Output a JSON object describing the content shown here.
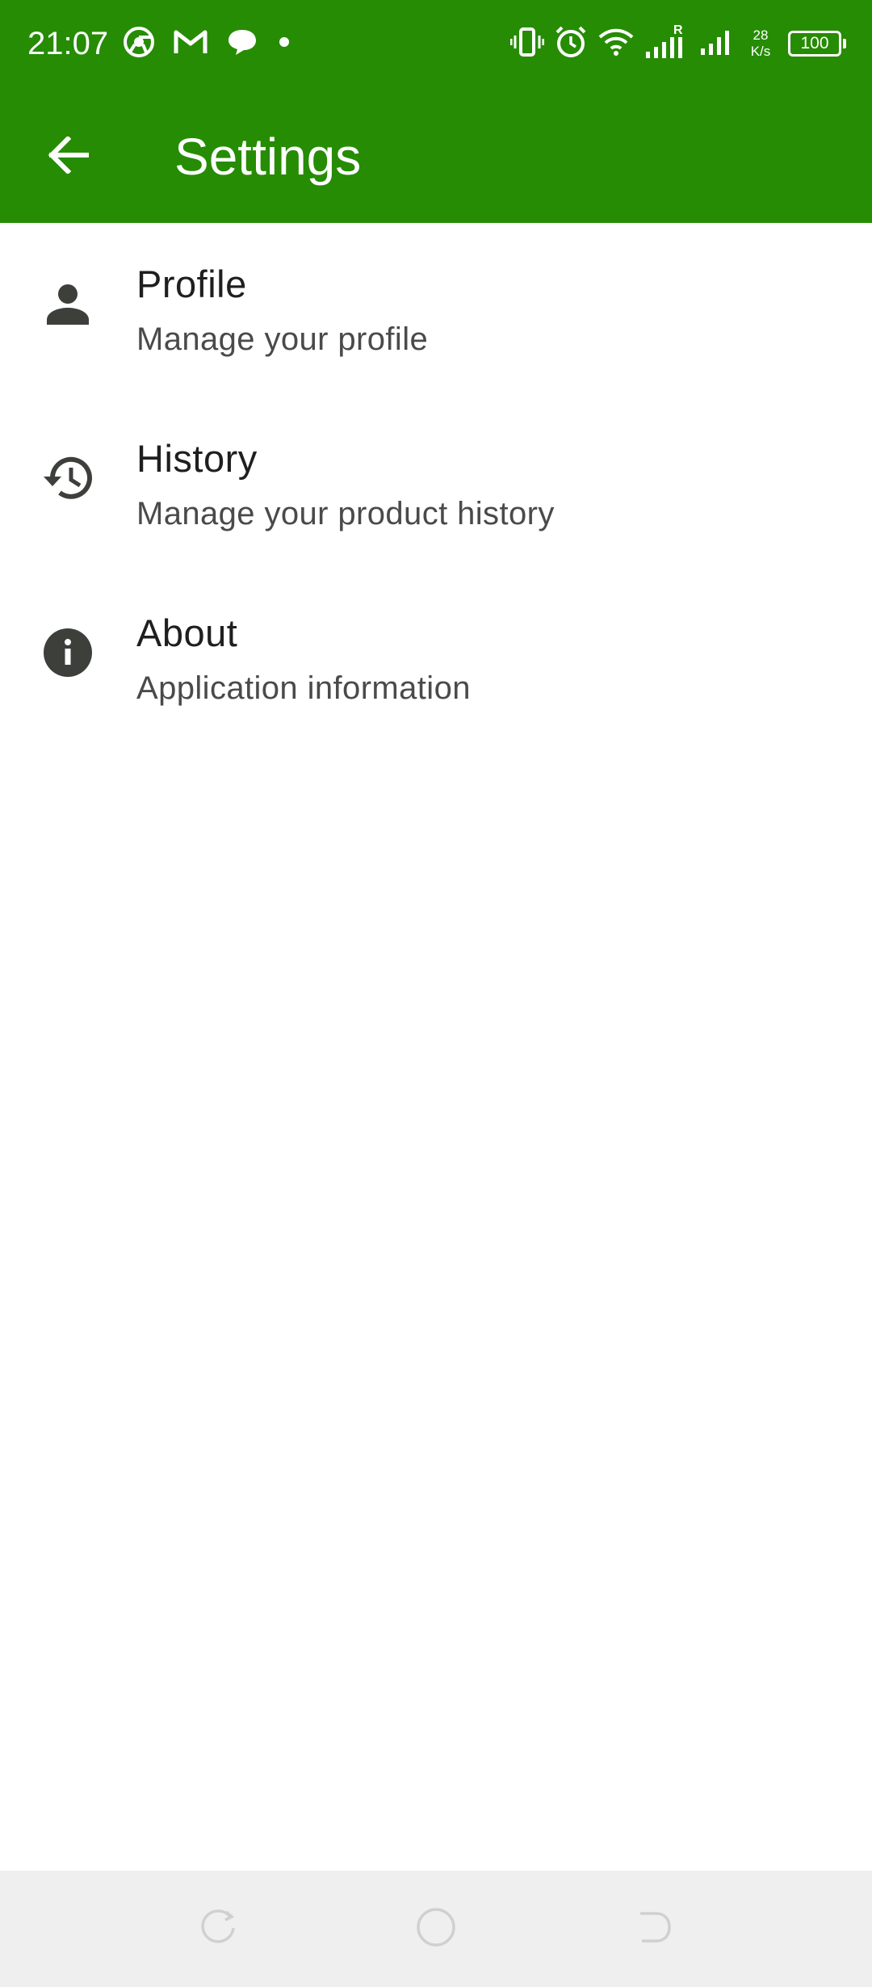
{
  "status_bar": {
    "time": "21:07",
    "net_speed_value": "28",
    "net_speed_unit": "K/s",
    "battery": "100",
    "icons": [
      "chrome-icon",
      "gmail-icon",
      "chat-icon",
      "dot-icon",
      "vibrate-icon",
      "alarm-icon",
      "wifi-icon",
      "signal-roaming-icon",
      "signal-icon"
    ]
  },
  "app_bar": {
    "title": "Settings",
    "color": "#268c04"
  },
  "settings": [
    {
      "icon": "person-icon",
      "title": "Profile",
      "subtitle": "Manage your profile"
    },
    {
      "icon": "history-icon",
      "title": "History",
      "subtitle": "Manage your product history"
    },
    {
      "icon": "info-icon",
      "title": "About",
      "subtitle": "Application information"
    }
  ],
  "nav_bar": {
    "buttons": [
      "recent-apps-icon",
      "home-icon",
      "back-icon"
    ]
  }
}
